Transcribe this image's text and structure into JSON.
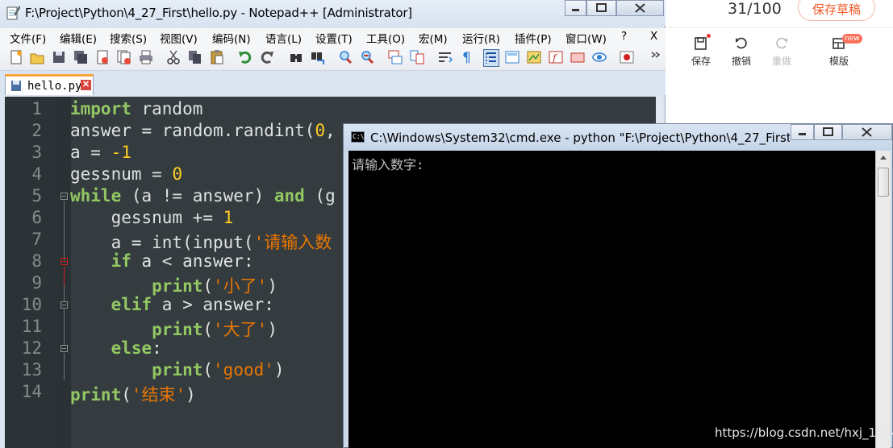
{
  "web_editor": {
    "word_counter": "31/100",
    "save_draft_label": "保存草稿",
    "tools": [
      {
        "label": "保存",
        "icon": "save-icon"
      },
      {
        "label": "撤销",
        "icon": "undo-icon"
      },
      {
        "label": "重做",
        "icon": "redo-icon"
      },
      {
        "label": "模版",
        "icon": "template-icon",
        "badge": "new"
      }
    ]
  },
  "notepad": {
    "title": "F:\\Project\\Python\\4_27_First\\hello.py - Notepad++ [Administrator]",
    "menu": [
      "文件(F)",
      "编辑(E)",
      "搜索(S)",
      "视图(V)",
      "编码(N)",
      "语言(L)",
      "设置(T)",
      "工具(O)",
      "宏(M)",
      "运行(R)",
      "插件(P)",
      "窗口(W)",
      "?",
      "X"
    ],
    "tab": {
      "label": "hello.py",
      "close": "✕"
    },
    "line_numbers": [
      "1",
      "2",
      "3",
      "4",
      "5",
      "6",
      "7",
      "8",
      "9",
      "10",
      "11",
      "12",
      "13",
      "14"
    ]
  },
  "cmd": {
    "title": "C:\\Windows\\System32\\cmd.exe - python  \"F:\\Project\\Python\\4_27_First...",
    "icon_text": "C:\\",
    "output": "请输入数字:"
  },
  "watermark": "https://blog.csdn.net/hxj_1544",
  "colors": {
    "editor_bg": "#343c40",
    "keyword": "#93c763",
    "number": "#ffcd22",
    "string": "#ec7600",
    "text": "#e0e2e4",
    "accent_orange": "#f05a28"
  }
}
